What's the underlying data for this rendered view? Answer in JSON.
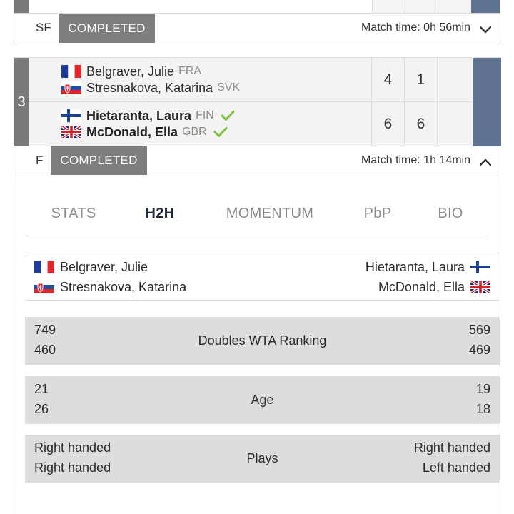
{
  "previous_match": {
    "round": "SF",
    "status": "COMPLETED",
    "match_time": "Match time: 0h 56min",
    "expand_icon": "chevron-down-icon"
  },
  "match": {
    "seed": "3",
    "team1": {
      "players": [
        {
          "name": "Belgraver, Julie",
          "nat": "FRA",
          "flag": "france-flag-icon"
        },
        {
          "name": "Stresnakova, Katarina",
          "nat": "SVK",
          "flag": "slovakia-flag-icon"
        }
      ],
      "scores": [
        "4",
        "1",
        ""
      ]
    },
    "team2": {
      "winner": true,
      "players": [
        {
          "name": "Hietaranta, Laura",
          "nat": "FIN",
          "flag": "finland-flag-icon"
        },
        {
          "name": "McDonald, Ella",
          "nat": "GBR",
          "flag": "uk-flag-icon"
        }
      ],
      "scores": [
        "6",
        "6",
        ""
      ]
    },
    "round": "F",
    "status": "COMPLETED",
    "match_time": "Match time: 1h 14min",
    "collapse_icon": "chevron-up-icon"
  },
  "tabs": [
    {
      "label": "STATS",
      "active": false
    },
    {
      "label": "H2H",
      "active": true
    },
    {
      "label": "MOMENTUM",
      "active": false
    },
    {
      "label": "PbP",
      "active": false
    },
    {
      "label": "BIO",
      "active": false
    }
  ],
  "h2h": {
    "left_players": [
      "Belgraver, Julie",
      "Stresnakova, Katarina"
    ],
    "right_players": [
      "Hietaranta, Laura",
      "McDonald, Ella"
    ],
    "stats": [
      {
        "label": "Doubles WTA Ranking",
        "left": [
          "749",
          "460"
        ],
        "right": [
          "569",
          "469"
        ]
      },
      {
        "label": "Age",
        "left": [
          "21",
          "26"
        ],
        "right": [
          "19",
          "18"
        ]
      },
      {
        "label": "Plays",
        "left": [
          "Right handed",
          "Right handed"
        ],
        "right": [
          "Right handed",
          "Left handed"
        ]
      }
    ]
  },
  "colors": {
    "badge": "#7e7e7e",
    "seed_strip": "#7a7a7a",
    "score_strip": "#5f7290",
    "win_check": "#7cc23a",
    "stat_band": "#dddddd"
  }
}
